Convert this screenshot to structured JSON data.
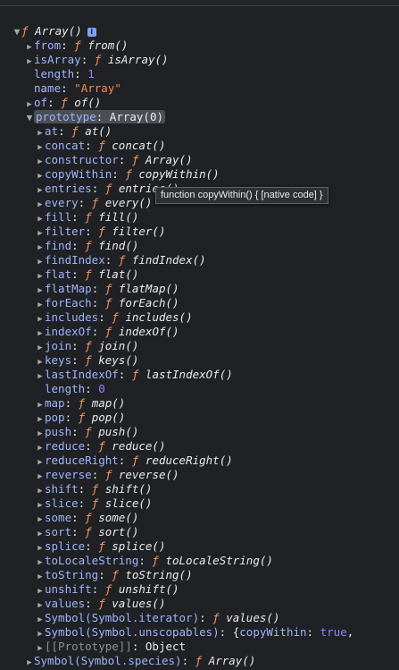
{
  "root": {
    "key": "Array()",
    "f": "ƒ",
    "info_glyph": "i"
  },
  "top_items": [
    {
      "kind": "func",
      "key": "from",
      "f": "ƒ",
      "value": "from()"
    },
    {
      "kind": "func",
      "key": "isArray",
      "f": "ƒ",
      "value": "isArray()"
    },
    {
      "kind": "num",
      "key": "length",
      "value": "1"
    },
    {
      "kind": "str",
      "key": "name",
      "value": "\"Array\""
    },
    {
      "kind": "func",
      "key": "of",
      "f": "ƒ",
      "value": "of()"
    }
  ],
  "prototype": {
    "key": "prototype",
    "value": "Array(0)"
  },
  "proto_items": [
    {
      "kind": "func",
      "key": "at",
      "f": "ƒ",
      "value": "at()"
    },
    {
      "kind": "func",
      "key": "concat",
      "f": "ƒ",
      "value": "concat()"
    },
    {
      "kind": "func",
      "key": "constructor",
      "f": "ƒ",
      "value": "Array()"
    },
    {
      "kind": "func",
      "key": "copyWithin",
      "f": "ƒ",
      "value": "copyWithin()"
    },
    {
      "kind": "func",
      "key": "entries",
      "f": "ƒ",
      "value": "entries()"
    },
    {
      "kind": "func",
      "key": "every",
      "f": "ƒ",
      "value": "every()"
    },
    {
      "kind": "func",
      "key": "fill",
      "f": "ƒ",
      "value": "fill()"
    },
    {
      "kind": "func",
      "key": "filter",
      "f": "ƒ",
      "value": "filter()"
    },
    {
      "kind": "func",
      "key": "find",
      "f": "ƒ",
      "value": "find()"
    },
    {
      "kind": "func",
      "key": "findIndex",
      "f": "ƒ",
      "value": "findIndex()"
    },
    {
      "kind": "func",
      "key": "flat",
      "f": "ƒ",
      "value": "flat()"
    },
    {
      "kind": "func",
      "key": "flatMap",
      "f": "ƒ",
      "value": "flatMap()"
    },
    {
      "kind": "func",
      "key": "forEach",
      "f": "ƒ",
      "value": "forEach()"
    },
    {
      "kind": "func",
      "key": "includes",
      "f": "ƒ",
      "value": "includes()"
    },
    {
      "kind": "func",
      "key": "indexOf",
      "f": "ƒ",
      "value": "indexOf()"
    },
    {
      "kind": "func",
      "key": "join",
      "f": "ƒ",
      "value": "join()"
    },
    {
      "kind": "func",
      "key": "keys",
      "f": "ƒ",
      "value": "keys()"
    },
    {
      "kind": "func",
      "key": "lastIndexOf",
      "f": "ƒ",
      "value": "lastIndexOf()"
    },
    {
      "kind": "num",
      "key": "length",
      "value": "0"
    },
    {
      "kind": "func",
      "key": "map",
      "f": "ƒ",
      "value": "map()"
    },
    {
      "kind": "func",
      "key": "pop",
      "f": "ƒ",
      "value": "pop()"
    },
    {
      "kind": "func",
      "key": "push",
      "f": "ƒ",
      "value": "push()"
    },
    {
      "kind": "func",
      "key": "reduce",
      "f": "ƒ",
      "value": "reduce()"
    },
    {
      "kind": "func",
      "key": "reduceRight",
      "f": "ƒ",
      "value": "reduceRight()"
    },
    {
      "kind": "func",
      "key": "reverse",
      "f": "ƒ",
      "value": "reverse()"
    },
    {
      "kind": "func",
      "key": "shift",
      "f": "ƒ",
      "value": "shift()"
    },
    {
      "kind": "func",
      "key": "slice",
      "f": "ƒ",
      "value": "slice()"
    },
    {
      "kind": "func",
      "key": "some",
      "f": "ƒ",
      "value": "some()"
    },
    {
      "kind": "func",
      "key": "sort",
      "f": "ƒ",
      "value": "sort()"
    },
    {
      "kind": "func",
      "key": "splice",
      "f": "ƒ",
      "value": "splice()"
    },
    {
      "kind": "func",
      "key": "toLocaleString",
      "f": "ƒ",
      "value": "toLocaleString()"
    },
    {
      "kind": "func",
      "key": "toString",
      "f": "ƒ",
      "value": "toString()"
    },
    {
      "kind": "func",
      "key": "unshift",
      "f": "ƒ",
      "value": "unshift()"
    },
    {
      "kind": "func",
      "key": "values",
      "f": "ƒ",
      "value": "values()"
    },
    {
      "kind": "func",
      "key": "Symbol(Symbol.iterator)",
      "f": "ƒ",
      "value": "values()"
    },
    {
      "kind": "unscop",
      "key": "Symbol(Symbol.unscopables)",
      "prefix": "{",
      "innerkey": "copyWithin",
      "innerval": "true",
      "suffix": ","
    },
    {
      "kind": "obj",
      "key": "[[Prototype]]",
      "value": "Object"
    }
  ],
  "last_item": {
    "key": "Symbol(Symbol.species)",
    "f": "ƒ",
    "value": "Array()"
  },
  "tooltip": "function copyWithin() { [native code] }",
  "colors": {
    "background": "#202124",
    "key": "#9fb4ff",
    "function_f": "#f29766",
    "number": "#9980ff",
    "string": "#f28b54"
  }
}
